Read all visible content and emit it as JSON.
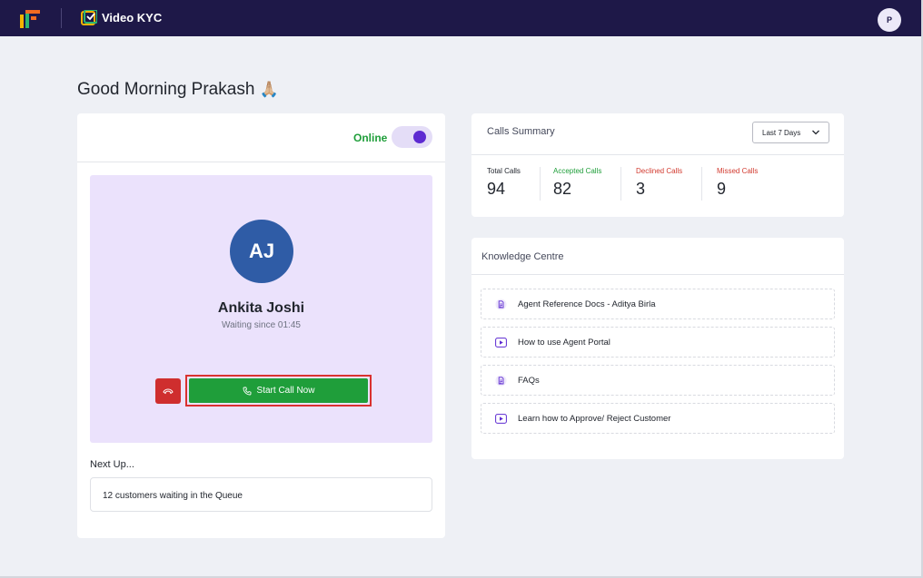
{
  "header": {
    "app_title": "Video KYC",
    "user_initial": "P",
    "brand_logo_icon": "brand-logo-icon",
    "app_icon": "video-kyc-icon"
  },
  "greeting": {
    "text": "Good Morning Prakash",
    "emoji": "🙏🏼"
  },
  "status": {
    "label": "Online",
    "online": true
  },
  "current_call": {
    "initials": "AJ",
    "name": "Ankita Joshi",
    "waiting": "Waiting since 01:45",
    "start_label": "Start Call Now",
    "decline_icon": "phone-hangup-icon",
    "start_icon": "phone-icon"
  },
  "queue": {
    "heading": "Next Up...",
    "text": "12 customers waiting in the Queue"
  },
  "calls_summary": {
    "title": "Calls Summary",
    "range_selected": "Last 7 Days",
    "stats": [
      {
        "label": "Total Calls",
        "value": "94",
        "color": "#22262e"
      },
      {
        "label": "Accepted Calls",
        "value": "82",
        "color": "#1f9e3a"
      },
      {
        "label": "Declined Calls",
        "value": "3",
        "color": "#d23a2f"
      },
      {
        "label": "Missed Calls",
        "value": "9",
        "color": "#d23a2f"
      }
    ]
  },
  "knowledge_centre": {
    "title": "Knowledge Centre",
    "items": [
      {
        "label": "Agent Reference Docs - Aditya Birla",
        "icon": "document-icon"
      },
      {
        "label": "How to use Agent Portal",
        "icon": "video-play-icon"
      },
      {
        "label": "FAQs",
        "icon": "document-icon"
      },
      {
        "label": "Learn how to Approve/ Reject Customer",
        "icon": "video-play-icon"
      }
    ]
  },
  "colors": {
    "header_bg": "#1e1848",
    "accent_purple": "#5d2ad1",
    "call_box_bg": "#ebe2fc",
    "success_green": "#1f9e3a",
    "danger_red": "#cf2e2e"
  }
}
